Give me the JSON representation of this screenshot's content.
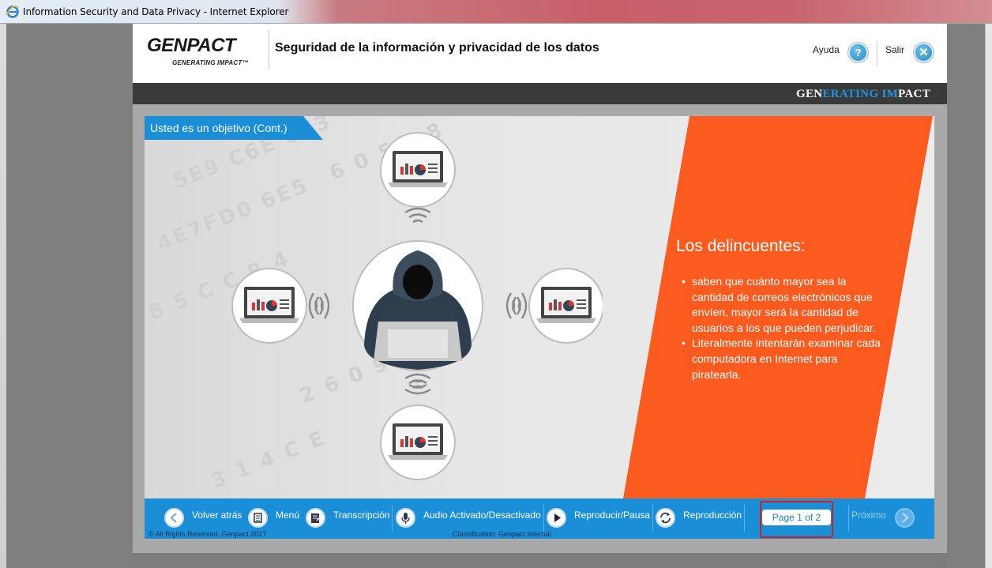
{
  "window": {
    "title": "Information Security and Data Privacy - Internet Explorer"
  },
  "header": {
    "brand": "GENPACT",
    "tagline": "GENERATING IMPACT™",
    "course_title": "Seguridad de la información y privacidad de los datos",
    "help_label": "Ayuda",
    "exit_label": "Salir"
  },
  "banner": {
    "part1": "GEN",
    "part2": "ERATING ",
    "part3": "IM",
    "part4": "PACT"
  },
  "slide": {
    "tab_title": "Usted es un objetivo (Cont.)",
    "panel_title": "Los delincuentes:",
    "bullets": [
      "saben que cuánto mayor sea la cantidad de correos electrónicos que envíen, mayor será la cantidad de usuarios a los que pueden perjudicar.",
      "Literalmente intentarán examinar cada computadora en Internet para piratearla."
    ]
  },
  "nav": {
    "back_label": "Volver atrás",
    "menu_label": "Menú",
    "transcript_label": "Transcripción",
    "audio_label": "Audio Activado/Desactivado",
    "play_label": "Reproducir/Pausa",
    "replay_label": "Reproducción",
    "page_indicator": "Page 1 of 2",
    "next_label": "Próximo",
    "copyright": "© All Rights Reserved. Genpact 2017",
    "classification": "Classification: Genpact Internal"
  },
  "colors": {
    "accent_blue": "#1a8fd8",
    "accent_orange": "#fb5b1f",
    "highlight_red": "#d31f1f"
  }
}
